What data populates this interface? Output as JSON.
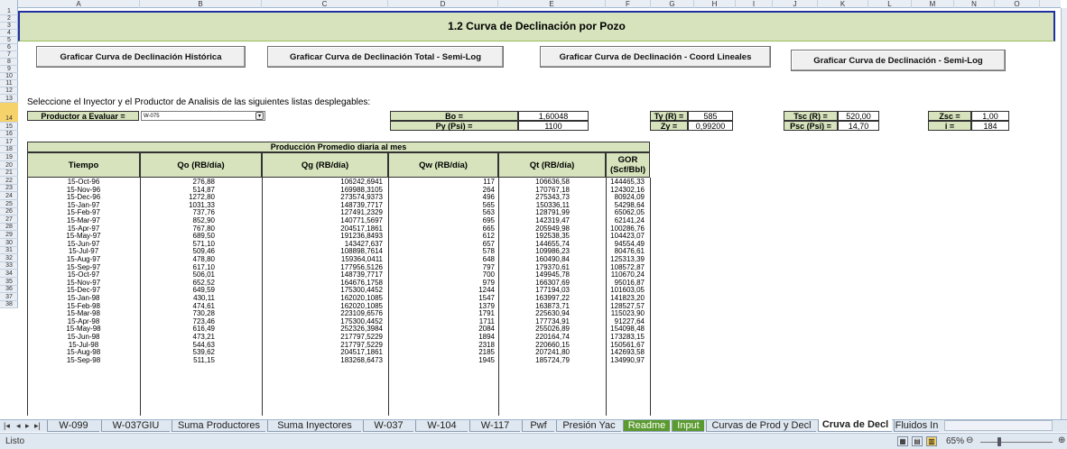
{
  "columns": [
    "A",
    "B",
    "C",
    "D",
    "E",
    "F",
    "G",
    "H",
    "I",
    "J",
    "K",
    "L",
    "M",
    "N",
    "O"
  ],
  "rows": [
    "1",
    "2",
    "3",
    "4",
    "5",
    "6",
    "7",
    "8",
    "9",
    "10",
    "11",
    "12",
    "13",
    "14",
    "15",
    "16",
    "17",
    "18",
    "19",
    "20",
    "21",
    "22",
    "23",
    "24",
    "25",
    "26",
    "27",
    "28",
    "29",
    "30",
    "31",
    "32",
    "33",
    "34",
    "35",
    "36",
    "37",
    "38"
  ],
  "sheet_title": "1.2 Curva de Declinación por Pozo",
  "buttons": {
    "hist": "Graficar Curva de Declinación Histórica",
    "total": "Graficar Curva de Declinación Total - Semi-Log",
    "coord": "Graficar Curva de Declinación - Coord Lineales",
    "semilog": "Graficar Curva de Declinación - Semi-Log"
  },
  "instruction": "Seleccione el Inyector y el Productor de Analisis de las siguientes listas desplegables:",
  "productor": {
    "label": "Productor a Evaluar =",
    "value": "W-075"
  },
  "params": {
    "bo_label": "Bo =",
    "bo_value": "1,60048",
    "py_label": "Py (Psi) =",
    "py_value": "1100",
    "ty_label": "Ty (R) =",
    "ty_value": "585",
    "zy_label": "Zy =",
    "zy_value": "0,99200",
    "tsc_label": "Tsc (R) =",
    "tsc_value": "520,00",
    "psc_label": "Psc (Psi) =",
    "psc_value": "14,70",
    "zsc_label": "Zsc =",
    "zsc_value": "1,00",
    "i_label": "i =",
    "i_value": "184"
  },
  "table": {
    "group_header": "Producción Promedio diaria al mes",
    "headers": [
      "Tiempo",
      "Qo (RB/día)",
      "Qg (RB/día)",
      "Qw (RB/día)",
      "Qt (RB/día)",
      "GOR (Scf/Bbl)"
    ],
    "rows": [
      [
        "15-Oct-96",
        "276,88",
        "106242,6941",
        "117",
        "106636,58",
        "144465,33"
      ],
      [
        "15-Nov-96",
        "514,87",
        "169988,3105",
        "264",
        "170767,18",
        "124302,16"
      ],
      [
        "15-Dec-96",
        "1272,80",
        "273574,9373",
        "496",
        "275343,73",
        "80924,09"
      ],
      [
        "15-Jan-97",
        "1031,33",
        "148739,7717",
        "565",
        "150336,11",
        "54298,64"
      ],
      [
        "15-Feb-97",
        "737,76",
        "127491,2329",
        "563",
        "128791,99",
        "65062,05"
      ],
      [
        "15-Mar-97",
        "852,90",
        "140771,5697",
        "695",
        "142319,47",
        "62141,24"
      ],
      [
        "15-Apr-97",
        "767,80",
        "204517,1861",
        "665",
        "205949,98",
        "100286,76"
      ],
      [
        "15-May-97",
        "689,50",
        "191236,8493",
        "612",
        "192538,35",
        "104423,07"
      ],
      [
        "15-Jun-97",
        "571,10",
        "143427,637",
        "657",
        "144655,74",
        "94554,49"
      ],
      [
        "15-Jul-97",
        "509,46",
        "108898,7614",
        "578",
        "109986,23",
        "80476,61"
      ],
      [
        "15-Aug-97",
        "478,80",
        "159364,0411",
        "648",
        "160490,84",
        "125313,39"
      ],
      [
        "15-Sep-97",
        "617,10",
        "177956,5126",
        "797",
        "179370,61",
        "108572,87"
      ],
      [
        "15-Oct-97",
        "506,01",
        "148739,7717",
        "700",
        "149945,78",
        "110670,24"
      ],
      [
        "15-Nov-97",
        "652,52",
        "164676,1758",
        "979",
        "166307,69",
        "95016,87"
      ],
      [
        "15-Dec-97",
        "649,59",
        "175300,4452",
        "1244",
        "177194,03",
        "101603,05"
      ],
      [
        "15-Jan-98",
        "430,11",
        "162020,1085",
        "1547",
        "163997,22",
        "141823,20"
      ],
      [
        "15-Feb-98",
        "474,61",
        "162020,1085",
        "1379",
        "163873,71",
        "128527,57"
      ],
      [
        "15-Mar-98",
        "730,28",
        "223109,6576",
        "1791",
        "225630,94",
        "115023,90"
      ],
      [
        "15-Apr-98",
        "723,46",
        "175300,4452",
        "1711",
        "177734,91",
        "91227,64"
      ],
      [
        "15-May-98",
        "616,49",
        "252326,3984",
        "2084",
        "255026,89",
        "154098,48"
      ],
      [
        "15-Jun-98",
        "473,21",
        "217797,5229",
        "1894",
        "220164,74",
        "173283,15"
      ],
      [
        "15-Jul-98",
        "544,63",
        "217797,5229",
        "2318",
        "220660,15",
        "150561,67"
      ],
      [
        "15-Aug-98",
        "539,62",
        "204517,1861",
        "2185",
        "207241,80",
        "142693,58"
      ],
      [
        "15-Sep-98",
        "511,15",
        "183268,6473",
        "1945",
        "185724,79",
        "134990,97"
      ]
    ]
  },
  "tabs": [
    "W-099",
    "W-037GIU",
    "Suma Productores",
    "Suma Inyectores",
    "W-037",
    "W-104",
    "W-117",
    "Pwf",
    "Presión Yac",
    "Readme",
    "Input",
    "Curvas de Prod y Decl",
    "Cruva de Decl",
    "Fluidos In"
  ],
  "active_tab": "Cruva de Decl",
  "status": "Listo",
  "zoom": "65%"
}
